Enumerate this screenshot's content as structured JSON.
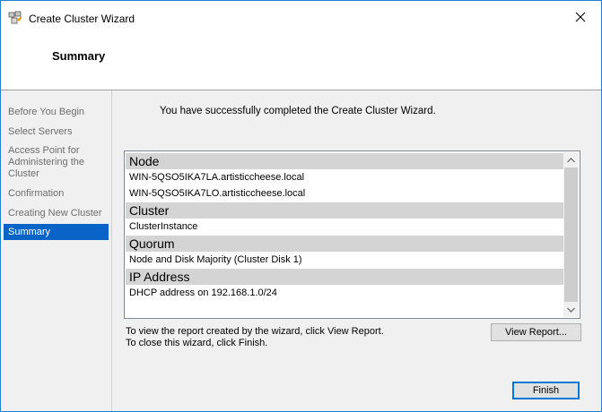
{
  "window": {
    "title": "Create Cluster Wizard",
    "close_symbol": "✕"
  },
  "header": {
    "title": "Summary"
  },
  "sidebar": {
    "items": [
      {
        "label": "Before You Begin"
      },
      {
        "label": "Select Servers"
      },
      {
        "label": "Access Point for Administering the Cluster"
      },
      {
        "label": "Confirmation"
      },
      {
        "label": "Creating New Cluster"
      },
      {
        "label": "Summary",
        "selected": true
      }
    ]
  },
  "main": {
    "success_message": "You have successfully completed the Create Cluster Wizard.",
    "report": {
      "sections": [
        {
          "heading": "Node",
          "rows": [
            "WIN-5QSO5IKA7LA.artisticcheese.local",
            "WIN-5QSO5IKA7LO.artisticcheese.local"
          ]
        },
        {
          "heading": "Cluster",
          "rows": [
            "ClusterInstance"
          ]
        },
        {
          "heading": "Quorum",
          "rows": [
            "Node and Disk Majority (Cluster Disk 1)"
          ]
        },
        {
          "heading": "IP Address",
          "rows": [
            "DHCP address on 192.168.1.0/24"
          ]
        }
      ]
    },
    "note_line1": "To view the report created by the wizard, click View Report.",
    "note_line2": "To close this wizard, click Finish.",
    "view_report_label": "View Report...",
    "finish_label": "Finish"
  },
  "colors": {
    "selection": "#0a64c8",
    "section_header_bg": "#d4d4d4",
    "panel_bg": "#f0f0f0"
  },
  "icons": [
    "cluster-app-icon",
    "close-icon",
    "scroll-up-icon",
    "scroll-down-icon"
  ]
}
